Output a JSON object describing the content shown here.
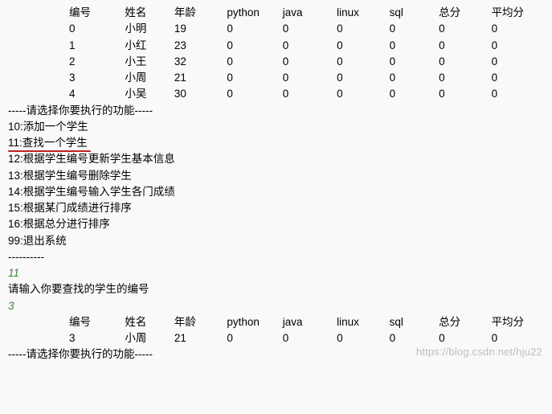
{
  "headers": {
    "id": "编号",
    "name": "姓名",
    "age": "年龄",
    "python": "python",
    "java": "java",
    "linux": "linux",
    "sql": "sql",
    "total": "总分",
    "avg": "平均分"
  },
  "students": [
    {
      "id": "0",
      "name": "小明",
      "age": "19",
      "python": "0",
      "java": "0",
      "linux": "0",
      "sql": "0",
      "total": "0",
      "avg": "0"
    },
    {
      "id": "1",
      "name": "小红",
      "age": "23",
      "python": "0",
      "java": "0",
      "linux": "0",
      "sql": "0",
      "total": "0",
      "avg": "0"
    },
    {
      "id": "2",
      "name": "小王",
      "age": "32",
      "python": "0",
      "java": "0",
      "linux": "0",
      "sql": "0",
      "total": "0",
      "avg": "0"
    },
    {
      "id": "3",
      "name": "小周",
      "age": "21",
      "python": "0",
      "java": "0",
      "linux": "0",
      "sql": "0",
      "total": "0",
      "avg": "0"
    },
    {
      "id": "4",
      "name": "小吴",
      "age": "30",
      "python": "0",
      "java": "0",
      "linux": "0",
      "sql": "0",
      "total": "0",
      "avg": "0"
    }
  ],
  "menu": {
    "title": "-----请选择你要执行的功能-----",
    "items": [
      "10:添加一个学生",
      "11:查找一个学生",
      "12:根据学生编号更新学生基本信息",
      "13:根据学生编号删除学生",
      "14:根据学生编号输入学生各门成绩",
      "15:根据某门成绩进行排序",
      "16:根据总分进行排序",
      "99:退出系统"
    ],
    "end": "----------"
  },
  "input1": "11",
  "prompt_find": "请输入你要查找的学生的编号",
  "input2": "3",
  "result": [
    {
      "id": "3",
      "name": "小周",
      "age": "21",
      "python": "0",
      "java": "0",
      "linux": "0",
      "sql": "0",
      "total": "0",
      "avg": "0"
    }
  ],
  "footer_menu": "-----请选择你要执行的功能-----",
  "watermark": "https://blog.csdn.net/hju22"
}
